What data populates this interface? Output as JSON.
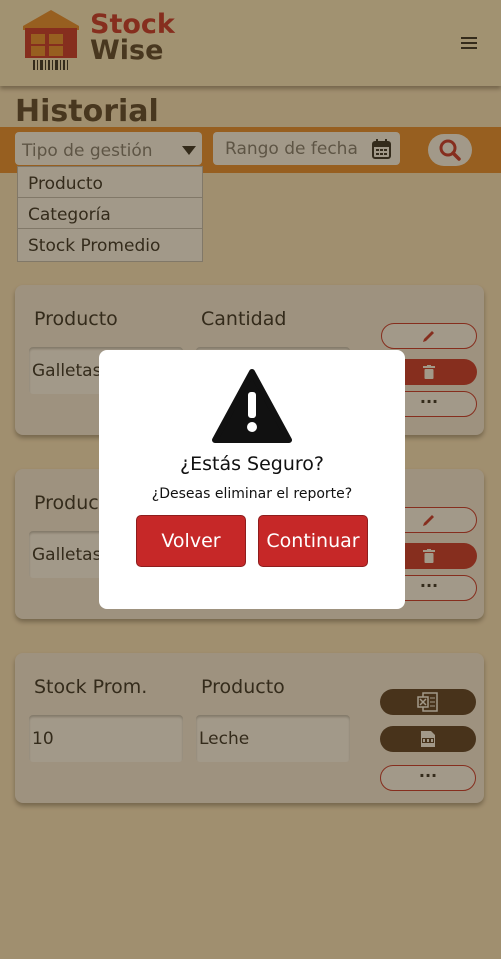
{
  "app": {
    "logo_line1": "Stock",
    "logo_line2": "Wise",
    "brand_red": "#c62828",
    "brand_orange": "#e88a2c"
  },
  "page": {
    "title": "Historial"
  },
  "filters": {
    "type_placeholder": "Tipo de gestión",
    "type_options": [
      "Producto",
      "Categoría",
      "Stock Promedio"
    ],
    "date_placeholder": "Rango de fecha"
  },
  "cards": [
    {
      "label1": "Producto",
      "label2": "Cantidad",
      "value1": "Galletas",
      "value2": "",
      "actions": [
        "edit-icon",
        "trash-icon",
        "..."
      ]
    },
    {
      "label1": "Producto",
      "label2": "",
      "value1": "Galletas",
      "value2": "",
      "actions": [
        "edit-icon",
        "trash-icon",
        "..."
      ]
    },
    {
      "label1": "Stock Prom.",
      "label2": "Producto",
      "value1": "10",
      "value2": "Leche",
      "actions": [
        "excel-icon",
        "pdf-icon",
        "..."
      ]
    }
  ],
  "modal": {
    "title": "¿Estás Seguro?",
    "message": "¿Deseas eliminar el reporte?",
    "back_label": "Volver",
    "continue_label": "Continuar"
  },
  "more_label": "..."
}
